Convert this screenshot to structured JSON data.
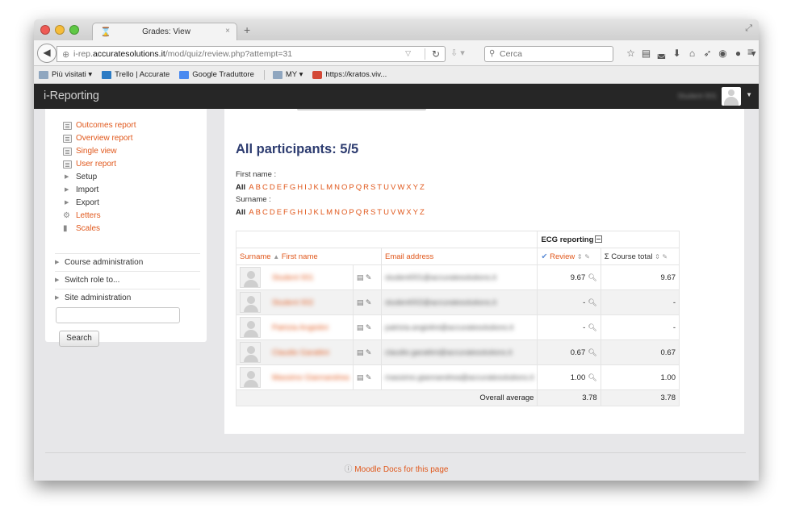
{
  "browser": {
    "tab_title": "Grades: View",
    "tab_close": "×",
    "new_tab": "+",
    "url_prefix": "i-rep.",
    "url_domain": "accuratesolutions.it",
    "url_path": "/mod/quiz/review.php?attempt=31",
    "search_placeholder": "Cerca",
    "bookmarks": [
      {
        "label": "Più visitati ▾",
        "icon": "folder-icon"
      },
      {
        "label": "Trello | Accurate",
        "icon": "trello-icon"
      },
      {
        "label": "Google Traduttore",
        "icon": "translate-icon"
      },
      {
        "label": "MY ▾",
        "icon": "folder-icon"
      },
      {
        "label": "https://kratos.viv...",
        "icon": "kratos-icon"
      }
    ]
  },
  "site": {
    "brand": "i-Reporting",
    "user_name": "Student 001"
  },
  "sidebar": {
    "items": [
      {
        "label": "Outcomes report",
        "icon": "report-icon"
      },
      {
        "label": "Overview report",
        "icon": "report-icon"
      },
      {
        "label": "Single view",
        "icon": "report-icon"
      },
      {
        "label": "User report",
        "icon": "report-icon"
      },
      {
        "label": "Setup",
        "icon": "triangle-icon"
      },
      {
        "label": "Import",
        "icon": "triangle-icon"
      },
      {
        "label": "Export",
        "icon": "triangle-icon"
      },
      {
        "label": "Letters",
        "icon": "gear-icon"
      },
      {
        "label": "Scales",
        "icon": "bar-chart-icon"
      }
    ],
    "sections": [
      "Course administration",
      "Switch role to...",
      "Site administration"
    ],
    "search_button": "Search"
  },
  "main": {
    "heading": "All participants: 5/5",
    "first_name_label": "First name :",
    "surname_label": "Surname :",
    "all_label": "All",
    "letters": [
      "A",
      "B",
      "C",
      "D",
      "E",
      "F",
      "G",
      "H",
      "I",
      "J",
      "K",
      "L",
      "M",
      "N",
      "O",
      "P",
      "Q",
      "R",
      "S",
      "T",
      "U",
      "V",
      "W",
      "X",
      "Y",
      "Z"
    ],
    "category": "ECG reporting",
    "columns": {
      "surname": "Surname",
      "sort_asc": "▲",
      "first_name": "First name",
      "email": "Email address",
      "review": "Review",
      "course_total": "Course total",
      "sigma": "Σ"
    },
    "rows": [
      {
        "name": "Student 001",
        "email": "student001@accuratesolutions.it",
        "review": "9.67",
        "total": "9.67"
      },
      {
        "name": "Student 002",
        "email": "student002@accuratesolutions.it",
        "review": "-",
        "total": "-"
      },
      {
        "name": "Patrizia Angiolini",
        "email": "patrizia.angiolini@accuratesolutions.it",
        "review": "-",
        "total": "-"
      },
      {
        "name": "Claudio Garattini",
        "email": "claudio.garattini@accuratesolutions.it",
        "review": "0.67",
        "total": "0.67"
      },
      {
        "name": "Massimo Giannandrea",
        "email": "massimo.giannandrea@accuratesolutions.it",
        "review": "1.00",
        "total": "1.00"
      }
    ],
    "overall_label": "Overall average",
    "overall_review": "3.78",
    "overall_total": "3.78"
  },
  "footer": {
    "docs_link": "Moodle Docs for this page"
  }
}
